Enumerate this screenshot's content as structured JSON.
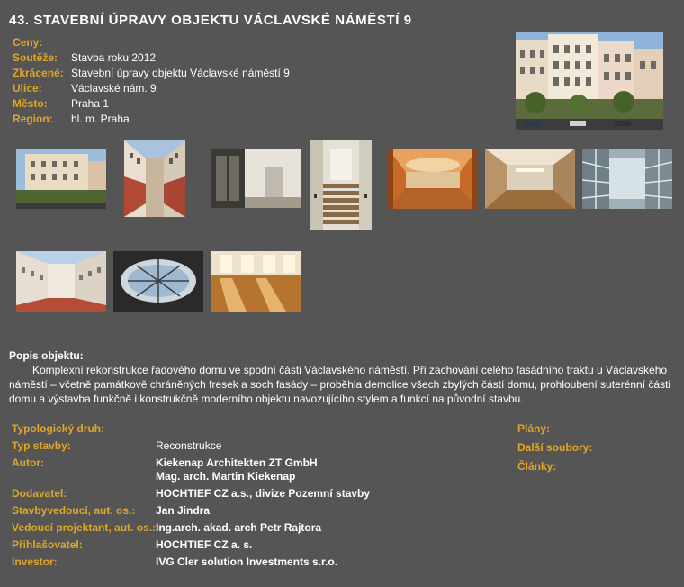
{
  "title": "43. STAVEBNÍ ÚPRAVY OBJEKTU VÁCLAVSKÉ NÁMĚSTÍ 9",
  "info": [
    {
      "label": "Ceny:",
      "value": ""
    },
    {
      "label": "Soutěže:",
      "value": "Stavba roku 2012"
    },
    {
      "label": "Zkrácené:",
      "value": "Stavební úpravy objektu Václavské náměstí 9"
    },
    {
      "label": "Ulice:",
      "value": "Václavské nám. 9"
    },
    {
      "label": "Město:",
      "value": "Praha 1"
    },
    {
      "label": "Region:",
      "value": "hl. m. Praha"
    }
  ],
  "description": {
    "heading": "Popis objektu:",
    "text": "Komplexní rekonstrukce řadového domu ve spodní části Václavského náměstí. Při zachování celého fasádního traktu u Václavského náměstí – včetně památkově chráněných fresek a soch fasády – proběhla demolice všech zbylých částí domu, prohloubení suterénní části domu a výstavba funkčně i konstrukčně moderního objektu navozujícího stylem a funkcí na původní stavbu."
  },
  "details": [
    {
      "label": "Typologický druh:",
      "value": ""
    },
    {
      "label": "Typ stavby:",
      "value": "Reconstrukce"
    },
    {
      "label": "Autor:",
      "value": "Kiekenap Architekten ZT GmbH",
      "value2": "Mag. arch. Martin Kiekenap"
    },
    {
      "label": "Dodavatel:",
      "value": "HOCHTIEF CZ a.s., divize Pozemní stavby"
    },
    {
      "label": "Stavbyvedoucí, aut. os.:",
      "value": "Jan Jindra"
    },
    {
      "label": "Vedoucí projektant, aut. os.:",
      "value": "Ing.arch. akad. arch Petr Rajtora"
    },
    {
      "label": "Přihlašovatel:",
      "value": "HOCHTIEF CZ a. s."
    },
    {
      "label": "Investor:",
      "value": "IVG Cler solution Investments s.r.o."
    }
  ],
  "right_links": [
    "Plány:",
    "Další soubory:",
    "Články:"
  ],
  "colors": {
    "background": "#555556",
    "label": "#e0a526",
    "text": "#ffffff"
  }
}
